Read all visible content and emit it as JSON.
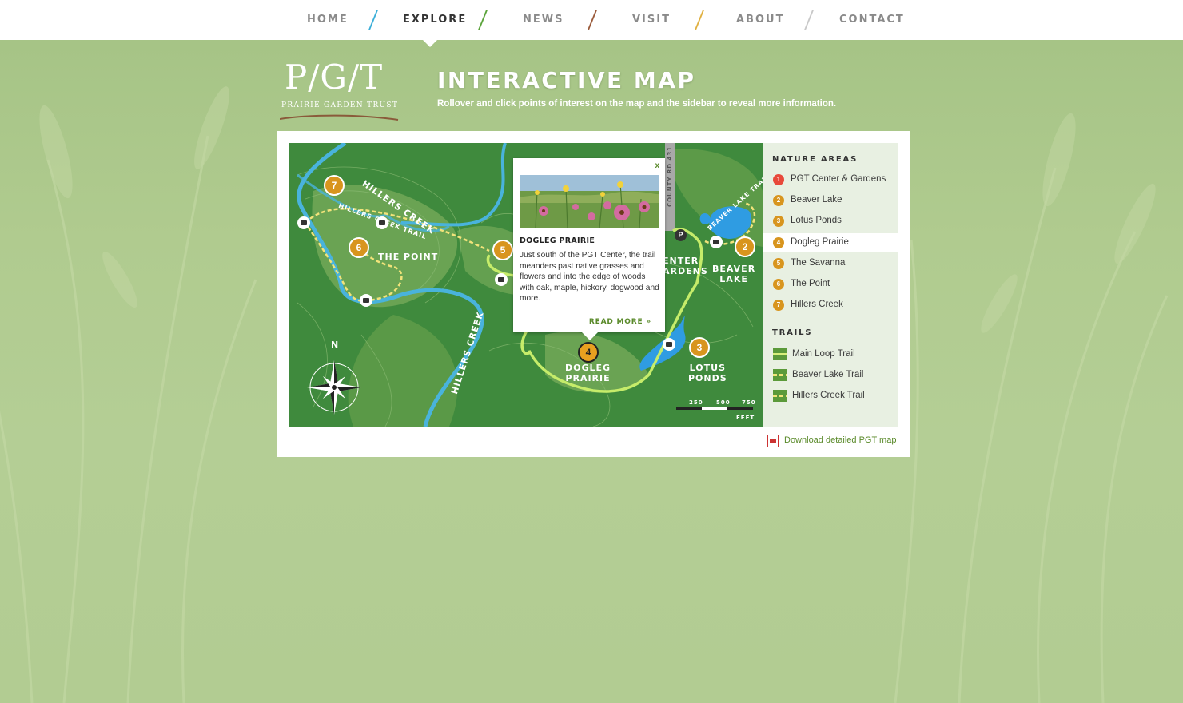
{
  "nav": {
    "items": [
      {
        "label": "HOME",
        "slash_color": "#3aaed8"
      },
      {
        "label": "EXPLORE",
        "slash_color": "#5aa33a"
      },
      {
        "label": "NEWS",
        "slash_color": "#9a5a3a"
      },
      {
        "label": "VISIT",
        "slash_color": "#e0b040"
      },
      {
        "label": "ABOUT",
        "slash_color": "#c8c8c8"
      },
      {
        "label": "CONTACT"
      }
    ],
    "active": "EXPLORE"
  },
  "logo": {
    "mark": "P/G/T",
    "subtitle": "PRAIRIE GARDEN TRUST"
  },
  "header": {
    "title": "INTERACTIVE MAP",
    "subtitle": "Rollover and click points of interest on the map and the sidebar to reveal more information."
  },
  "map": {
    "labels": {
      "hillers_creek_top": "HILLERS CREEK",
      "hillers_creek_trail": "HILLERS CREEK TRAIL",
      "the_point": "THE POINT",
      "hillers_creek_bottom": "HILLERS CREEK",
      "center_gardens": "ENTER\nARDENS",
      "beaver_lake": "BEAVER\nLAKE",
      "beaver_lake_trail": "BEAVER LAKE TRAIL",
      "dogleg_prairie": "DOGLEG\nPRAIRIE",
      "lotus_ponds": "LOTUS\nPONDS",
      "county_rd": "COUNTY RD 431",
      "compass_n": "N"
    },
    "scale": {
      "ticks": [
        "250",
        "500",
        "750"
      ],
      "unit": "FEET"
    },
    "pois": [
      "2",
      "3",
      "4",
      "5",
      "6",
      "7"
    ],
    "parking": "P",
    "active_poi": "4"
  },
  "popup": {
    "close": "x",
    "title": "DOGLEG PRAIRIE",
    "body": "Just south of the PGT Center, the trail meanders past native grasses and flowers and into the edge of woods with oak, maple, hickory, dogwood and more.",
    "read_more": "READ MORE »"
  },
  "sidebar": {
    "nature_heading": "NATURE AREAS",
    "nature_areas": [
      {
        "num": "1",
        "label": "PGT Center & Gardens",
        "color": "#e8493a"
      },
      {
        "num": "2",
        "label": "Beaver Lake",
        "color": "#d8951e"
      },
      {
        "num": "3",
        "label": "Lotus Ponds",
        "color": "#d8951e"
      },
      {
        "num": "4",
        "label": "Dogleg Prairie",
        "color": "#d8951e"
      },
      {
        "num": "5",
        "label": "The Savanna",
        "color": "#d8951e"
      },
      {
        "num": "6",
        "label": "The Point",
        "color": "#d8951e"
      },
      {
        "num": "7",
        "label": "Hillers Creek",
        "color": "#d8951e"
      }
    ],
    "active_area": "Dogleg Prairie",
    "trails_heading": "TRAILS",
    "trails": [
      {
        "label": "Main Loop Trail",
        "style": "solid"
      },
      {
        "label": "Beaver Lake Trail",
        "style": "dashed"
      },
      {
        "label": "Hillers Creek Trail",
        "style": "dashed"
      }
    ]
  },
  "download": {
    "label": "Download detailed PGT map"
  },
  "colors": {
    "accent_green": "#5a8a2a",
    "poi_orange": "#d8951e",
    "poi_red": "#e8493a",
    "map_green": "#3f8a3d",
    "water_blue": "#3a9ad8"
  }
}
